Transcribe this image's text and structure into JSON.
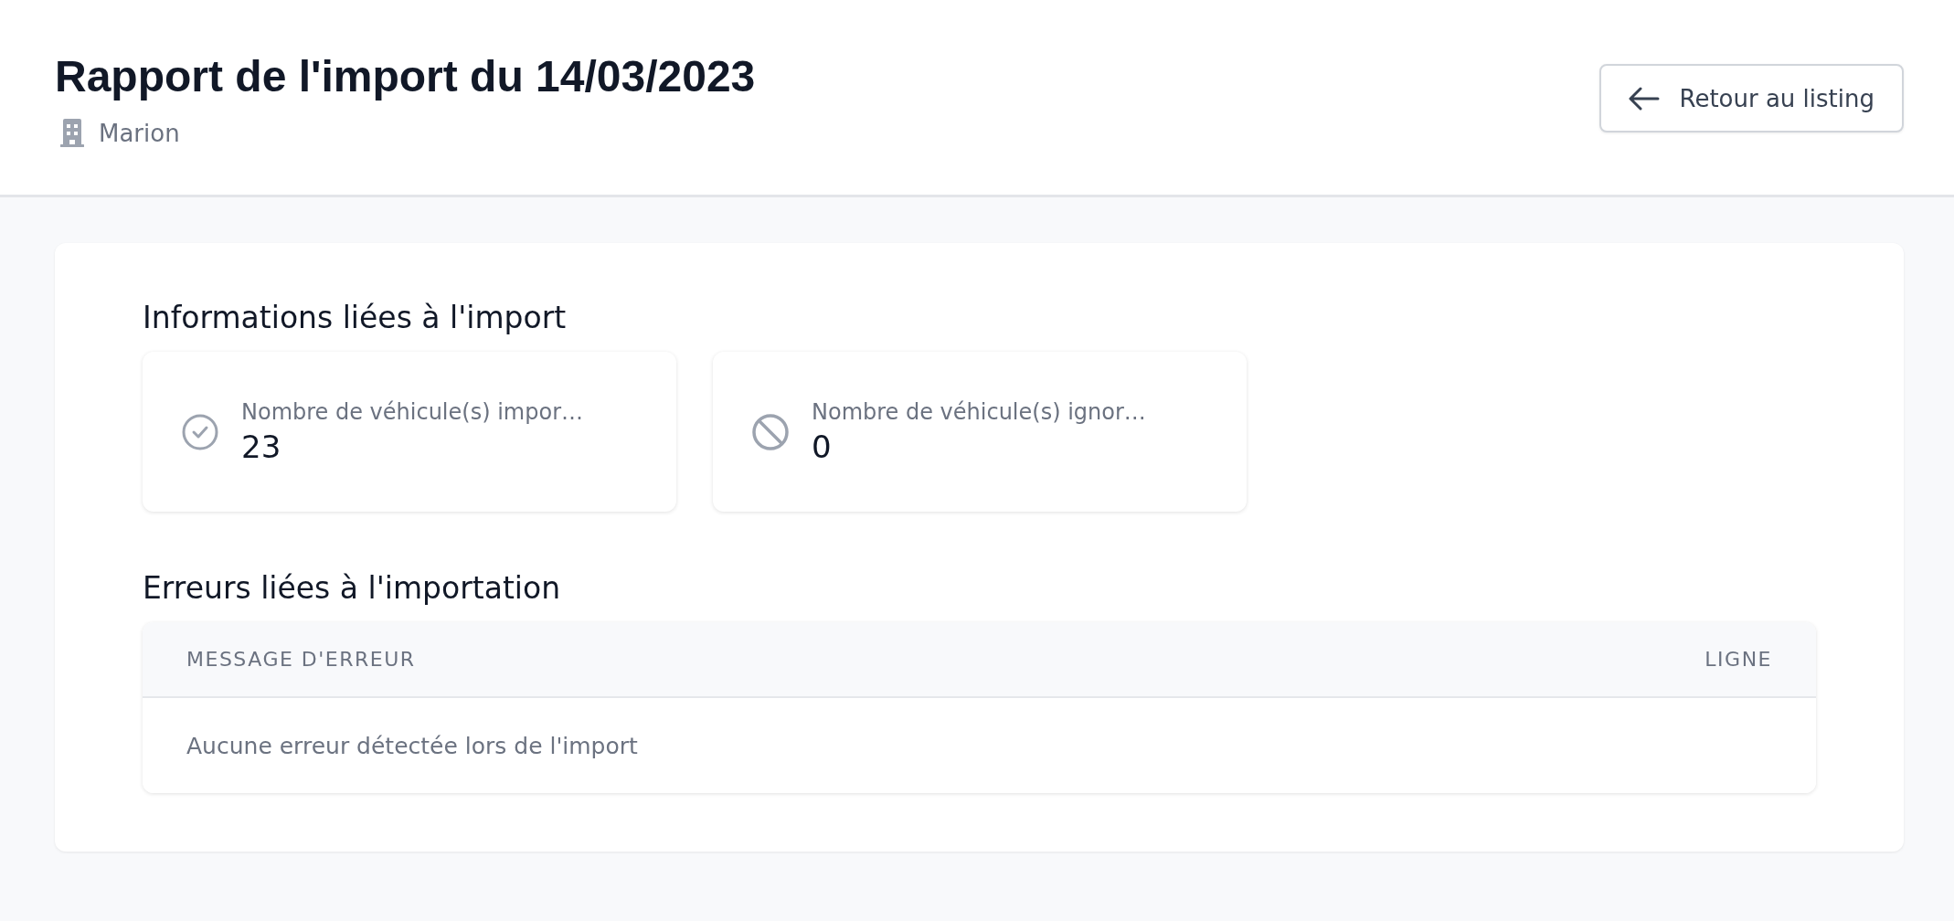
{
  "header": {
    "title": "Rapport de l'import du 14/03/2023",
    "subtitle": "Marion",
    "back_button": "Retour au listing"
  },
  "info_section": {
    "title": "Informations liées à l'import",
    "stats": [
      {
        "kind": "imported",
        "label": "Nombre de véhicule(s) impor…",
        "value": "23"
      },
      {
        "kind": "ignored",
        "label": "Nombre de véhicule(s) ignor…",
        "value": "0"
      }
    ]
  },
  "errors_section": {
    "title": "Erreurs liées à l'importation",
    "table": {
      "columns": [
        "MESSAGE D'ERREUR",
        "LIGNE"
      ],
      "empty_message": "Aucune erreur détectée lors de l'import"
    }
  }
}
